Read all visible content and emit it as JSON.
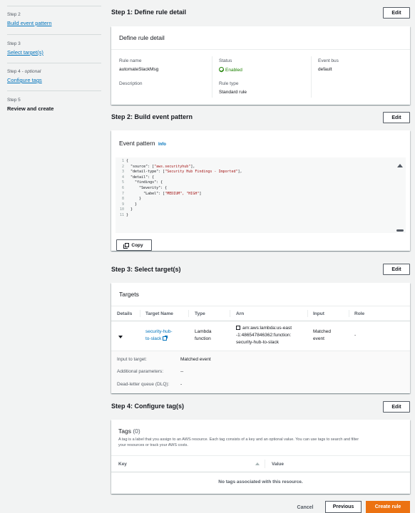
{
  "nav": {
    "step2": {
      "num": "Step 2",
      "label": "Build event pattern"
    },
    "step3": {
      "num": "Step 3",
      "label": "Select target(s)"
    },
    "step4": {
      "num": "Step 4",
      "optional": "optional",
      "label": "Configure tags"
    },
    "step5": {
      "num": "Step 5",
      "label": "Review and create"
    }
  },
  "edit_label": "Edit",
  "step1": {
    "title": "Step 1: Define rule detail",
    "panel_title": "Define rule detail",
    "rule_name_key": "Rule name",
    "rule_name": "automateSlackMsg",
    "status_key": "Status",
    "status": "Enabled",
    "event_bus_key": "Event bus",
    "event_bus": "default",
    "description_key": "Description",
    "rule_type_key": "Rule type",
    "rule_type": "Standard rule"
  },
  "step2": {
    "title": "Step 2: Build event pattern",
    "panel_title": "Event pattern",
    "info": "Info",
    "code_lines": [
      {
        "n": "1",
        "pre": "{",
        "s": "",
        "post": ""
      },
      {
        "n": "2",
        "pre": "  \"source\": [",
        "s": "\"aws.securityhub\"",
        "post": "],"
      },
      {
        "n": "3",
        "pre": "  \"detail-type\": [",
        "s": "\"Security Hub Findings - Imported\"",
        "post": "],"
      },
      {
        "n": "4",
        "pre": "  \"detail\": {",
        "s": "",
        "post": ""
      },
      {
        "n": "5",
        "pre": "    \"findings\": {",
        "s": "",
        "post": ""
      },
      {
        "n": "6",
        "pre": "      \"Severity\": {",
        "s": "",
        "post": ""
      },
      {
        "n": "7",
        "pre": "        \"Label\": [",
        "s": "\"MEDIUM\", \"HIGH\"",
        "post": "]"
      },
      {
        "n": "8",
        "pre": "      }",
        "s": "",
        "post": ""
      },
      {
        "n": "9",
        "pre": "    }",
        "s": "",
        "post": ""
      },
      {
        "n": "10",
        "pre": "  }",
        "s": "",
        "post": ""
      },
      {
        "n": "11",
        "pre": "}",
        "s": "",
        "post": ""
      }
    ],
    "copy": "Copy"
  },
  "step3": {
    "title": "Step 3: Select target(s)",
    "panel_title": "Targets",
    "columns": {
      "details": "Details",
      "target_name": "Target Name",
      "type": "Type",
      "arn": "Arn",
      "input": "Input",
      "role": "Role"
    },
    "row": {
      "target_name_1": "security-hub-",
      "target_name_2": "to-slack",
      "type_1": "Lambda",
      "type_2": "function",
      "arn_1": "arn:aws:lambda:us-east",
      "arn_2": "-1:486547846362:function:",
      "arn_3": "security-hub-to-slack",
      "input_1": "Matched",
      "input_2": "event",
      "role": "-"
    },
    "input_to_target_key": "Input to target:",
    "input_to_target": "Matched event",
    "additional_params_key": "Additional parameters:",
    "additional_params": "--",
    "dlq_key": "Dead-letter queue (DLQ):",
    "dlq": "-"
  },
  "step4": {
    "title": "Step 4: Configure tag(s)",
    "panel_title": "Tags",
    "count": "(0)",
    "desc_1": "A tag is a label that you assign to an AWS resource. Each tag consists of a key and an optional value. You can use tags to search and filter",
    "desc_2": "your resources or track your AWS costs.",
    "col_key": "Key",
    "col_value": "Value",
    "empty": "No tags associated with this resource."
  },
  "footer": {
    "cancel": "Cancel",
    "previous": "Previous",
    "create": "Create rule"
  },
  "colors": {
    "accent": "#ec7211",
    "link": "#0073bb",
    "success": "#1d8102"
  }
}
